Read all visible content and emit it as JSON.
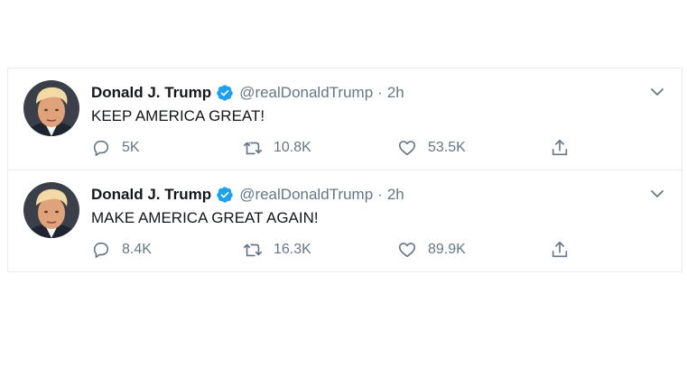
{
  "tweets": [
    {
      "name": "Donald J. Trump",
      "handle": "@realDonaldTrump",
      "separator": "·",
      "time": "2h",
      "text": "KEEP AMERICA GREAT!",
      "replies": "5K",
      "retweets": "10.8K",
      "likes": "53.5K"
    },
    {
      "name": "Donald J. Trump",
      "handle": "@realDonaldTrump",
      "separator": "·",
      "time": "2h",
      "text": "MAKE AMERICA GREAT AGAIN!",
      "replies": "8.4K",
      "retweets": "16.3K",
      "likes": "89.9K"
    }
  ],
  "icons": {
    "reply": "reply-icon",
    "retweet": "retweet-icon",
    "like": "heart-icon",
    "share": "share-icon",
    "verified": "verified-badge-icon",
    "more": "chevron-down-icon"
  },
  "colors": {
    "name": "#14171a",
    "secondary": "#657786",
    "verified": "#1da1f2",
    "divider": "#e6ecf0"
  }
}
